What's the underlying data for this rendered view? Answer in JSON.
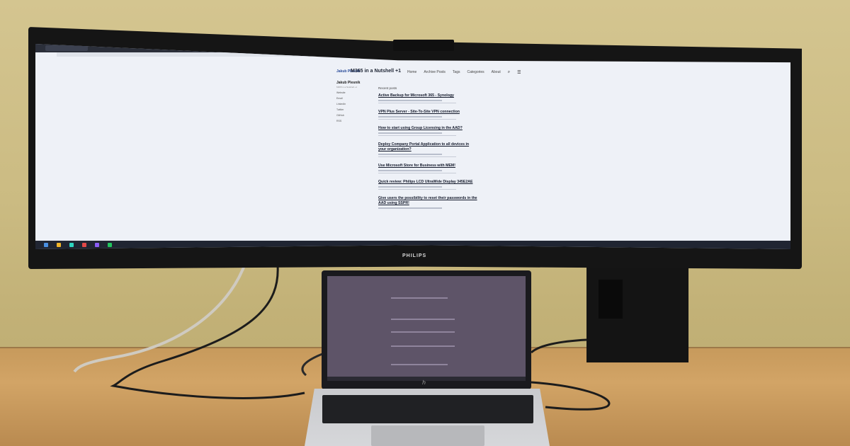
{
  "monitor": {
    "brand": "PHILIPS"
  },
  "blog": {
    "brand": "Jakub Plesník",
    "title": "M365 in a Nutshell +1",
    "nav": [
      "Home",
      "Archive Posts",
      "Tags",
      "Categories",
      "About"
    ],
    "sidebar": {
      "author": "Jakub Plesník",
      "author_sub": "M365 in a Nutshell +1",
      "social": [
        "Website",
        "Email",
        "LinkedIn",
        "Twitter",
        "GitHub",
        "RSS"
      ]
    },
    "recent_heading": "Recent posts",
    "posts": [
      "Active Backup for Microsoft 365 - Synology",
      "VPN Plus Server - Site-To-Site VPN connection",
      "How to start using Group Licensing in the AAD?",
      "Deploy Company Portal Application to all devices in your organization?",
      "Use Microsoft Store for Business with MEM!",
      "Quick review: Philips LCD UltraWide Display 345E2AE",
      "Give users the possibility to reset their passwords in the AAD using SSPR!"
    ]
  },
  "colors": {
    "wall": "#cbbb82",
    "desk": "#c79a5c",
    "screen": "#eef1f7",
    "bezel": "#151515"
  }
}
